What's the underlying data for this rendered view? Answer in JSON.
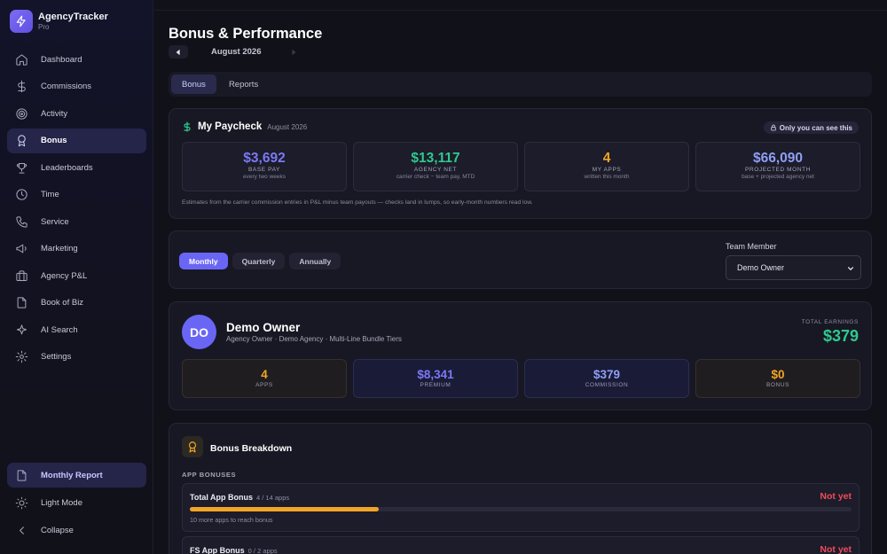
{
  "brand": {
    "name": "AgencyTracker",
    "tier": "Pro"
  },
  "sidebar": {
    "items": [
      {
        "label": "Dashboard",
        "icon": "home-icon"
      },
      {
        "label": "Commissions",
        "icon": "dollar-icon"
      },
      {
        "label": "Activity",
        "icon": "target-icon"
      },
      {
        "label": "Bonus",
        "icon": "award-icon",
        "active": true
      },
      {
        "label": "Leaderboards",
        "icon": "trophy-icon"
      },
      {
        "label": "Time",
        "icon": "clock-icon"
      },
      {
        "label": "Service",
        "icon": "phone-icon"
      },
      {
        "label": "Marketing",
        "icon": "megaphone-icon"
      },
      {
        "label": "Agency P&L",
        "icon": "briefcase-icon"
      },
      {
        "label": "Book of Biz",
        "icon": "file-icon"
      },
      {
        "label": "AI Search",
        "icon": "sparkle-icon"
      },
      {
        "label": "Settings",
        "icon": "gear-icon"
      }
    ],
    "monthly_report": "Monthly Report",
    "light_mode": "Light Mode",
    "collapse": "Collapse"
  },
  "header": {
    "title": "Bonus & Performance",
    "month": "August 2026"
  },
  "tabs": [
    {
      "label": "Bonus",
      "active": true
    },
    {
      "label": "Reports",
      "active": false
    }
  ],
  "paycheck": {
    "title": "My Paycheck",
    "month": "August 2026",
    "private_badge": "Only you can see this",
    "stats": [
      {
        "value": "$3,692",
        "label": "BASE PAY",
        "sub": "every two weeks",
        "color": "#7b78f6"
      },
      {
        "value": "$13,117",
        "label": "AGENCY NET",
        "sub": "carrier check − team pay, MTD",
        "color": "#2fc98e"
      },
      {
        "value": "4",
        "label": "MY APPS",
        "sub": "written this month",
        "color": "#f2a526"
      },
      {
        "value": "$66,090",
        "label": "PROJECTED MONTH",
        "sub": "base + projected agency net",
        "color": "#8f9ff5"
      }
    ],
    "note": "Estimates from the carrier commission entries in P&L minus team payouts — checks land in lumps, so early-month numbers read low."
  },
  "filters": {
    "periods": [
      {
        "label": "Monthly",
        "active": true
      },
      {
        "label": "Quarterly",
        "active": false
      },
      {
        "label": "Annually",
        "active": false
      }
    ],
    "team_member_label": "Team Member",
    "team_member_value": "Demo Owner"
  },
  "profile": {
    "initials": "DO",
    "name": "Demo Owner",
    "subtitle": "Agency Owner · Demo Agency · Multi-Line Bundle Tiers",
    "total_label": "TOTAL EARNINGS",
    "total": "$379",
    "stats": [
      {
        "value": "4",
        "label": "APPS",
        "color": "#f2a526"
      },
      {
        "value": "$8,341",
        "label": "PREMIUM",
        "color": "#7b78f6"
      },
      {
        "value": "$379",
        "label": "COMMISSION",
        "color": "#8f9ff5"
      },
      {
        "value": "$0",
        "label": "BONUS",
        "color": "#f2a526"
      }
    ]
  },
  "breakdown": {
    "title": "Bonus Breakdown",
    "section": "APP BONUSES",
    "rows": [
      {
        "name": "Total App Bonus",
        "count": "4 / 14 apps",
        "status": "Not yet",
        "progress": 0.2857,
        "note": "10 more apps to reach bonus"
      },
      {
        "name": "FS App Bonus",
        "count": "0 / 2 apps",
        "status": "Not yet",
        "progress": 0
      }
    ]
  },
  "colors": {
    "accent": "#6a66f5",
    "green": "#2fc98e",
    "orange": "#f2a526",
    "red": "#f04a5a"
  }
}
